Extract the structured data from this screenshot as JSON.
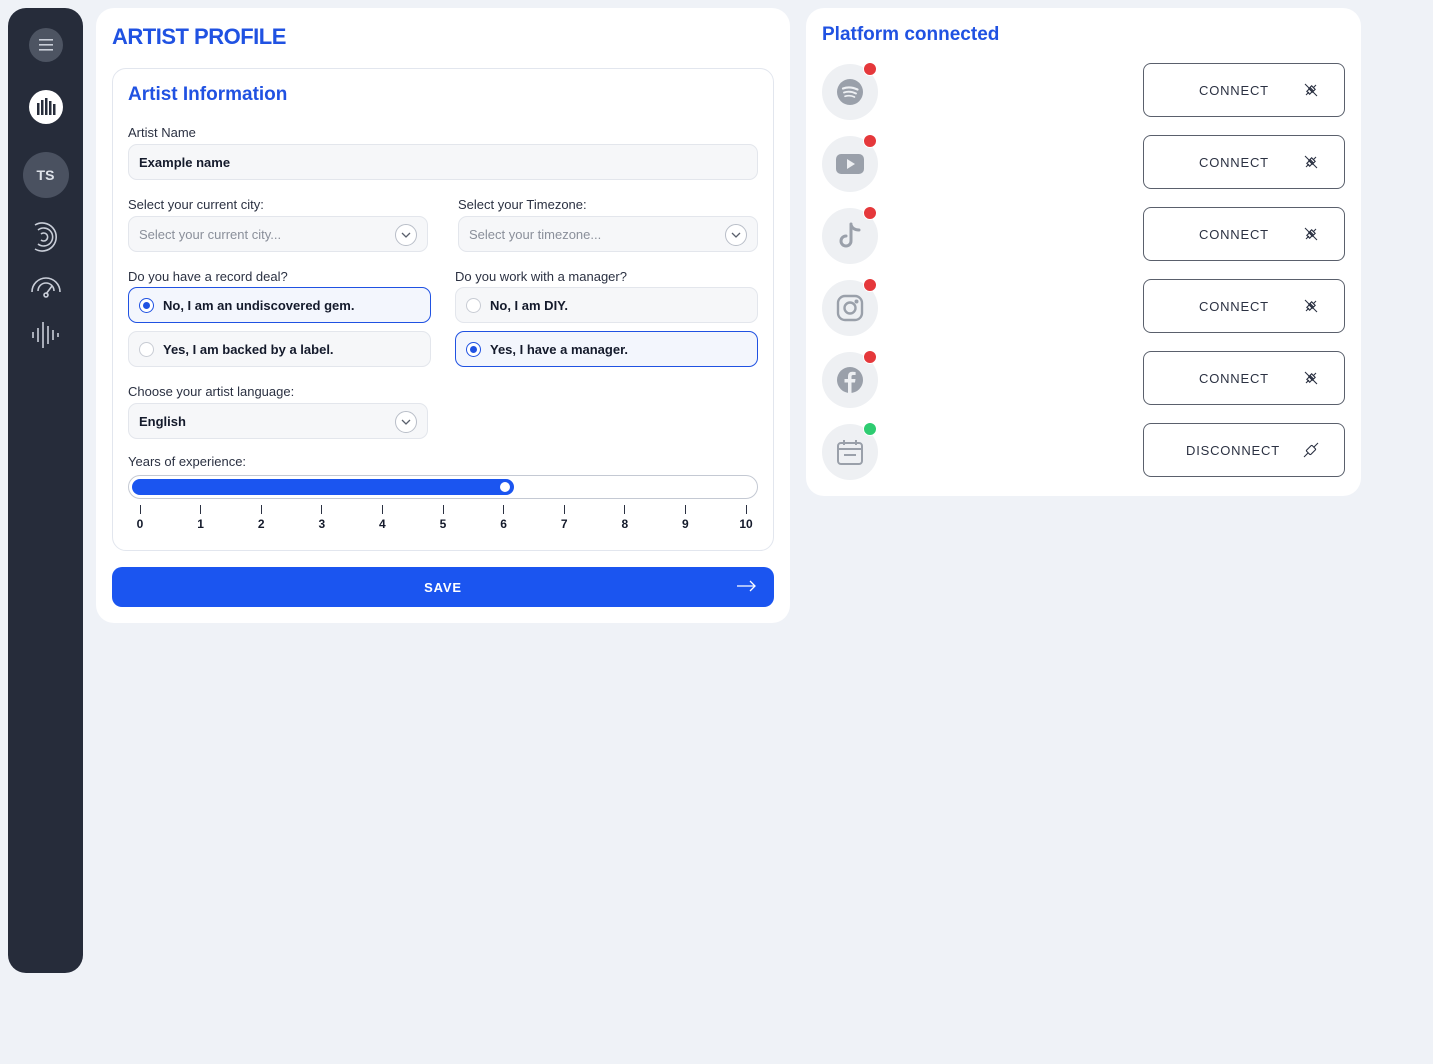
{
  "sidebar": {
    "avatar_initials": "TS",
    "icons": [
      "menu-icon",
      "sound-bars-logo-icon",
      "signal-arcs-icon",
      "gauge-icon",
      "waveform-icon"
    ]
  },
  "profile": {
    "title": "ARTIST PROFILE",
    "section_title": "Artist Information",
    "artist_name_label": "Artist Name",
    "artist_name_value": "Example name",
    "city_label": "Select your current city:",
    "city_placeholder": "Select your current city...",
    "timezone_label": "Select your Timezone:",
    "timezone_placeholder": "Select your timezone...",
    "record_deal_label": "Do you have a record deal?",
    "record_deal_options": [
      "No, I am an undiscovered gem.",
      "Yes, I am backed by a label."
    ],
    "record_deal_selected": 0,
    "manager_label": "Do you work with a manager?",
    "manager_options": [
      "No, I am DIY.",
      "Yes, I have a manager."
    ],
    "manager_selected": 1,
    "language_label": "Choose your artist language:",
    "language_value": "English",
    "experience_label": "Years of experience:",
    "experience_min": 0,
    "experience_max": 10,
    "experience_value": 6,
    "experience_ticks": [
      "0",
      "1",
      "2",
      "3",
      "4",
      "5",
      "6",
      "7",
      "8",
      "9",
      "10"
    ],
    "save_label": "SAVE"
  },
  "platforms": {
    "title": "Platform connected",
    "items": [
      {
        "icon": "spotify-icon",
        "status": "disconnected",
        "status_color": "#e5383b",
        "button_label": "CONNECT"
      },
      {
        "icon": "youtube-icon",
        "status": "disconnected",
        "status_color": "#e5383b",
        "button_label": "CONNECT"
      },
      {
        "icon": "tiktok-icon",
        "status": "disconnected",
        "status_color": "#e5383b",
        "button_label": "CONNECT"
      },
      {
        "icon": "instagram-icon",
        "status": "disconnected",
        "status_color": "#e5383b",
        "button_label": "CONNECT"
      },
      {
        "icon": "facebook-icon",
        "status": "disconnected",
        "status_color": "#e5383b",
        "button_label": "CONNECT"
      },
      {
        "icon": "calendar-icon",
        "status": "connected",
        "status_color": "#2ecc71",
        "button_label": "DISCONNECT"
      }
    ]
  },
  "colors": {
    "accent": "#2052e2",
    "primary_button": "#1b55f0",
    "sidebar_bg": "#262c3a",
    "page_bg": "#eff2f7"
  }
}
